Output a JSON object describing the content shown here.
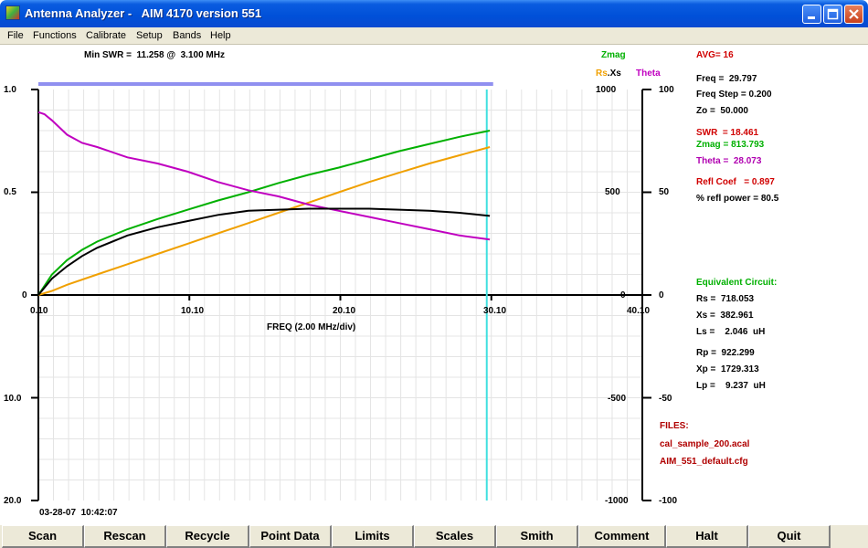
{
  "window": {
    "title": "Antenna Analyzer -   AIM 4170 version 551"
  },
  "menu": [
    "File",
    "Functions",
    "Calibrate",
    "Setup",
    "Bands",
    "Help"
  ],
  "header": {
    "min_swr": "Min SWR =  11.258 @  3.100 MHz",
    "zmag": "Zmag",
    "rs": "Rs",
    "dot": ".",
    "xs": "Xs",
    "theta": "Theta"
  },
  "axes": {
    "left_top": [
      "1.0",
      "0.5",
      "0"
    ],
    "left_bottom": [
      "10.0",
      "20.0"
    ],
    "zmag_ticks": [
      "1000",
      "500",
      "0",
      "-500",
      "-1000"
    ],
    "theta_ticks": [
      "100",
      "50",
      "0",
      "-50",
      "-100"
    ],
    "x_ticks": [
      "0.10",
      "10.10",
      "20.10",
      "30.10",
      "40.10"
    ],
    "x_label": "FREQ (2.00 MHz/div)"
  },
  "timestamp": "03-28-07  10:42:07",
  "readout": {
    "avg": "AVG= 16",
    "freq": "Freq =  29.797",
    "freq_step": "Freq Step = 0.200",
    "zo": "Zo =  50.000",
    "swr": "SWR  = 18.461",
    "zmag": "Zmag = 813.793",
    "theta": "Theta =  28.073",
    "refl_coef": "Refl Coef   = 0.897",
    "refl_power": "% refl power = 80.5",
    "eq_title": "Equivalent Circuit:",
    "rs": "Rs =  718.053",
    "xs": "Xs =  382.961",
    "ls": "Ls =    2.046  uH",
    "rp": "Rp =  922.299",
    "xp": "Xp =  1729.313",
    "lp": "Lp =    9.237  uH",
    "files_title": "FILES:",
    "file1": "cal_sample_200.acal",
    "file2": "AIM_551_default.cfg"
  },
  "buttons": [
    "Scan",
    "Rescan",
    "Recycle",
    "Point Data",
    "Limits",
    "Scales",
    "Smith",
    "Comment",
    "Halt",
    "Quit"
  ],
  "colors": {
    "zmag": "#00b000",
    "rs": "#f0a000",
    "theta": "#c000c0",
    "swr": "#000000",
    "cursor": "#40e0e0",
    "scan_bar": "#9090f0",
    "red_label": "#d00000",
    "green_label": "#00b000",
    "magenta_label": "#b000b0"
  },
  "chart_data": {
    "type": "line",
    "xlabel": "FREQ (2.00 MHz/div)",
    "xlim": [
      0.1,
      40.1
    ],
    "cursor_x": 29.797,
    "series": [
      {
        "name": "Zmag",
        "axis": "ohms",
        "ylim": [
          -1000,
          1000
        ],
        "x": [
          0.1,
          1,
          2,
          3,
          4,
          6,
          8,
          10,
          12,
          14,
          16,
          18,
          20,
          22,
          24,
          26,
          28,
          30
        ],
        "y": [
          0,
          100,
          170,
          220,
          260,
          320,
          370,
          415,
          460,
          500,
          545,
          585,
          620,
          660,
          700,
          735,
          770,
          800
        ]
      },
      {
        "name": "Rs",
        "axis": "ohms",
        "ylim": [
          -1000,
          1000
        ],
        "x": [
          0.1,
          1,
          2,
          4,
          6,
          8,
          10,
          12,
          14,
          16,
          18,
          20,
          22,
          24,
          26,
          28,
          30
        ],
        "y": [
          0,
          20,
          50,
          100,
          150,
          200,
          250,
          300,
          350,
          400,
          450,
          500,
          550,
          595,
          640,
          680,
          720
        ]
      },
      {
        "name": "Theta",
        "axis": "degrees",
        "ylim": [
          -100,
          100
        ],
        "x": [
          0.1,
          0.5,
          1,
          2,
          3,
          4,
          6,
          8,
          10,
          12,
          14,
          16,
          18,
          20,
          22,
          24,
          26,
          28,
          30
        ],
        "y": [
          89,
          88,
          85,
          78,
          74,
          72,
          67,
          64,
          60,
          55,
          51,
          48,
          44,
          41,
          38,
          35,
          32,
          29,
          27
        ]
      },
      {
        "name": "SWR",
        "axis": "swr",
        "ylim": [
          0,
          1
        ],
        "x": [
          0.1,
          1,
          2,
          3,
          4,
          6,
          8,
          10,
          12,
          14,
          16,
          18,
          19,
          20,
          22,
          24,
          26,
          28,
          30
        ],
        "y": [
          0,
          0.08,
          0.14,
          0.19,
          0.23,
          0.29,
          0.33,
          0.36,
          0.39,
          0.41,
          0.415,
          0.42,
          0.42,
          0.42,
          0.42,
          0.415,
          0.41,
          0.4,
          0.385
        ]
      }
    ]
  }
}
